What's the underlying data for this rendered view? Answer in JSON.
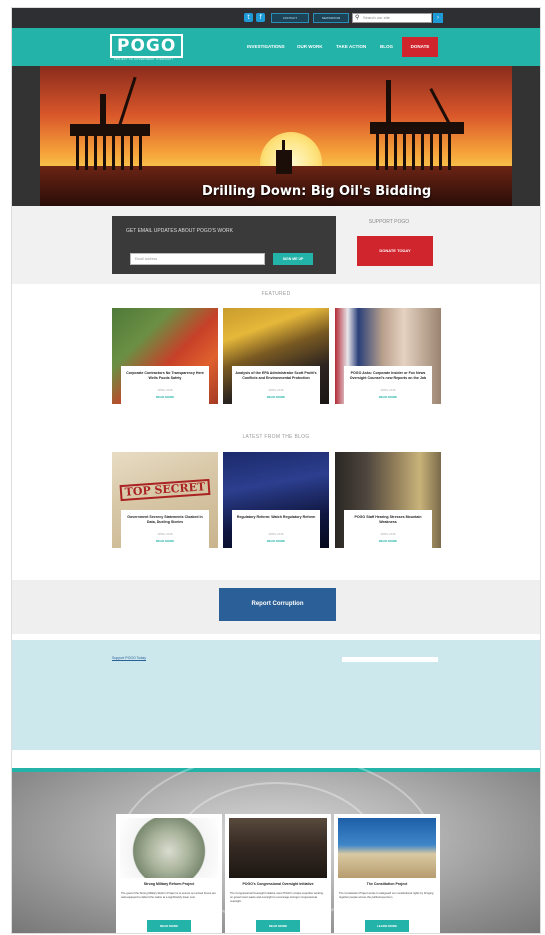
{
  "topbar": {
    "social": [
      {
        "icon": "twitter-icon",
        "glyph": "t"
      },
      {
        "icon": "facebook-icon",
        "glyph": "f"
      }
    ],
    "btn1": "CONTACT",
    "btn2": "NEWSROOM",
    "search_placeholder": "Search our site"
  },
  "nav": {
    "logo": "POGO",
    "logo_sub": "PROJECT ON GOVERNMENT OVERSIGHT",
    "items": [
      "INVESTIGATIONS",
      "OUR WORK",
      "TAKE ACTION",
      "BLOG"
    ],
    "donate": "DONATE"
  },
  "hero": {
    "title": "Drilling Down: Big Oil's Bidding"
  },
  "signup": {
    "title": "GET EMAIL UPDATES ABOUT POGO'S WORK",
    "placeholder": "Email address",
    "button": "SIGN ME UP"
  },
  "support": {
    "title": "SUPPORT POGO",
    "button": "DONATE TODAY"
  },
  "featured": {
    "title": "FEATURED",
    "cards": [
      {
        "title": "Corporate Contractors No Transparency Here Wells Foods Safety",
        "date": "APRIL 2018",
        "more": "READ MORE"
      },
      {
        "title": "Analysis of the EPA Administrator Scott Pruitt's Conflicts and Environmental Protection",
        "date": "APRIL 2018",
        "more": "READ MORE"
      },
      {
        "title": "POGO Asks: Corporate Insider or Fox News Oversight Counsel's new Reports on the Job",
        "date": "APRIL 2018",
        "more": "READ MORE"
      }
    ]
  },
  "latest": {
    "title": "LATEST FROM THE BLOG",
    "cards": [
      {
        "title": "Government Secrecy Statements Cloaked in Data, Dueling Stories",
        "date": "APRIL 2018",
        "more": "READ MORE"
      },
      {
        "title": "Regulatory Reform: Watch Regulatory Reform",
        "date": "APRIL 2018",
        "more": "READ MORE"
      },
      {
        "title": "POGO Staff Hearing Stresses Mountain Weakness",
        "date": "APRIL 2018",
        "more": "READ MORE"
      }
    ]
  },
  "report": {
    "button": "Report Corruption"
  },
  "blue": {
    "link": "Support POGO Today"
  },
  "projects": [
    {
      "title": "Strong Military Reform Project",
      "text": "The goal of the Strong Military Reform Project is to ensure our armed forces are well-equipped to defend the nation at a significantly lower cost.",
      "button": "READ MORE"
    },
    {
      "title": "POGO's Congressional Oversight Initiative",
      "text": "The Congressional Oversight Initiative uses POGO's unique expertise working on government waste and oversight to encourage stronger congressional oversight.",
      "button": "READ MORE"
    },
    {
      "title": "The Constitution Project",
      "text": "The Constitution Project works to safeguard our constitutional rights by bringing together people across the political spectrum.",
      "button": "LEARN MORE"
    }
  ],
  "colors": {
    "teal": "#23b3a8",
    "red": "#d1252e",
    "navy": "#2b5f97",
    "dark": "#2d2f33"
  }
}
